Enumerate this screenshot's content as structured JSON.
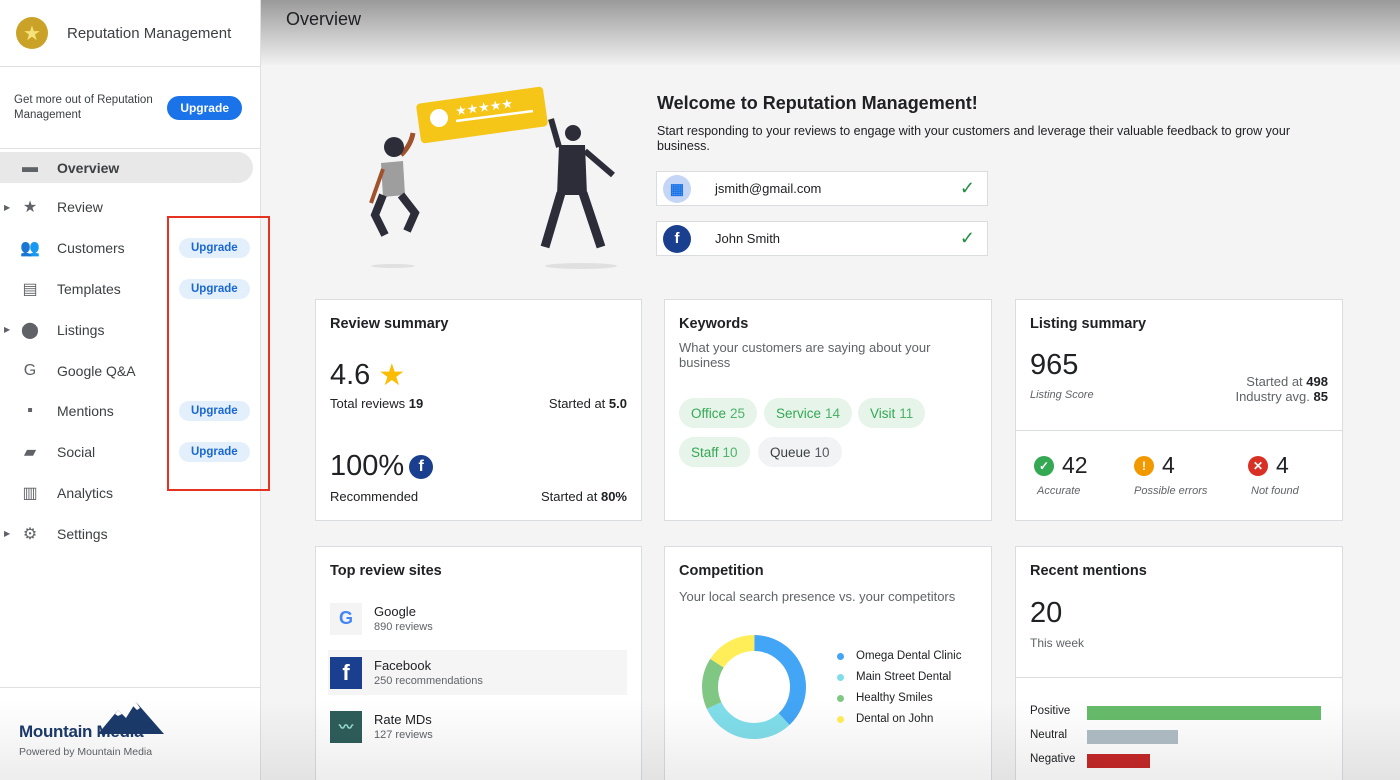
{
  "app": {
    "title": "Reputation Management",
    "page_title": "Overview"
  },
  "upsell": {
    "text": "Get more out of Reputation Management",
    "button": "Upgrade"
  },
  "nav": [
    {
      "label": "Overview",
      "icon": "dashboard-icon",
      "active": true
    },
    {
      "label": "Review",
      "icon": "star-icon",
      "expandable": true
    },
    {
      "label": "Customers",
      "icon": "people-icon",
      "badge": "Upgrade"
    },
    {
      "label": "Templates",
      "icon": "document-icon",
      "badge": "Upgrade"
    },
    {
      "label": "Listings",
      "icon": "location-pin-icon",
      "expandable": true
    },
    {
      "label": "Google Q&A",
      "icon": "google-g-icon"
    },
    {
      "label": "Mentions",
      "icon": "comment-icon",
      "badge": "Upgrade"
    },
    {
      "label": "Social",
      "icon": "forum-icon",
      "badge": "Upgrade"
    },
    {
      "label": "Analytics",
      "icon": "bar-chart-icon"
    },
    {
      "label": "Settings",
      "icon": "gear-icon",
      "expandable": true
    }
  ],
  "footer": {
    "brand": "Mountain Media",
    "powered": "Powered by Mountain Media"
  },
  "welcome": {
    "title": "Welcome to Reputation Management!",
    "subtitle": "Start responding to your reviews to engage with your customers and leverage their valuable feedback to grow your business.",
    "accounts": [
      {
        "text": "jsmith@gmail.com",
        "icon": "google-business-icon"
      },
      {
        "text": "John Smith",
        "icon": "facebook-icon"
      }
    ]
  },
  "review_summary": {
    "title": "Review summary",
    "rating": "4.6",
    "total_label": "Total reviews",
    "total": "19",
    "started_rating_label": "Started at",
    "started_rating": "5.0",
    "recommended": "100%",
    "recommended_label": "Recommended",
    "started_rec_label": "Started at",
    "started_rec": "80%"
  },
  "keywords": {
    "title": "Keywords",
    "subtitle": "What your customers are saying about your business",
    "chips": [
      {
        "label": "Office",
        "count": "25",
        "tone": "green"
      },
      {
        "label": "Service",
        "count": "14",
        "tone": "green"
      },
      {
        "label": "Visit",
        "count": "11",
        "tone": "green"
      },
      {
        "label": "Staff",
        "count": "10",
        "tone": "green"
      },
      {
        "label": "Queue",
        "count": "10",
        "tone": "gray"
      }
    ]
  },
  "listing_summary": {
    "title": "Listing summary",
    "score": "965",
    "score_label": "Listing Score",
    "started_label": "Started at",
    "started": "498",
    "industry_label": "Industry avg.",
    "industry": "85",
    "stats": [
      {
        "value": "42",
        "label": "Accurate",
        "color": "#34a853",
        "symbol": "✓"
      },
      {
        "value": "4",
        "label": "Possible errors",
        "color": "#f29900",
        "symbol": "!"
      },
      {
        "value": "4",
        "label": "Not found",
        "color": "#d93025",
        "symbol": "✕"
      }
    ]
  },
  "top_sites": {
    "title": "Top review sites",
    "sites": [
      {
        "name": "Google",
        "meta": "890 reviews",
        "icon": "google-icon"
      },
      {
        "name": "Facebook",
        "meta": "250 recommendations",
        "icon": "facebook-icon"
      },
      {
        "name": "Rate MDs",
        "meta": "127 reviews",
        "icon": "ratemds-icon"
      }
    ]
  },
  "competition": {
    "title": "Competition",
    "subtitle": "Your local search presence vs. your competitors",
    "legend": [
      {
        "name": "Omega Dental Clinic",
        "color": "#42a5f5"
      },
      {
        "name": "Main Street Dental",
        "color": "#80deea"
      },
      {
        "name": "Healthy Smiles",
        "color": "#81c784"
      },
      {
        "name": "Dental on John",
        "color": "#ffee58"
      }
    ]
  },
  "recent_mentions": {
    "title": "Recent mentions",
    "count": "20",
    "period": "This week",
    "sentiment": [
      {
        "label": "Positive",
        "share": 1.0,
        "color": "#66bb6a"
      },
      {
        "label": "Neutral",
        "share": 0.39,
        "color": "#b0bec5"
      },
      {
        "label": "Negative",
        "share": 0.27,
        "color": "#c62828"
      }
    ]
  },
  "chart_data": {
    "type": "pie",
    "title": "Competition",
    "categories": [
      "Omega Dental Clinic",
      "Main Street Dental",
      "Healthy Smiles",
      "Dental on John"
    ],
    "values": [
      38,
      30,
      16,
      16
    ]
  }
}
